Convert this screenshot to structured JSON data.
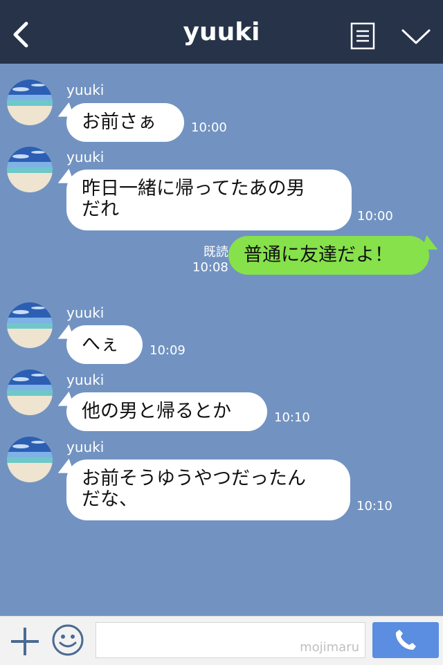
{
  "header": {
    "title": "yuuki"
  },
  "messages": [
    {
      "name": "yuuki",
      "lines": [
        "お前さぁ"
      ],
      "time": "10:00"
    },
    {
      "name": "yuuki",
      "lines": [
        "昨日一緒に帰ってたあの男",
        "だれ"
      ],
      "time": "10:00"
    },
    {
      "mine_text": "普通に友達だよ！",
      "read_label": "既読",
      "time": "10:08"
    },
    {
      "name": "yuuki",
      "lines": [
        "へぇ"
      ],
      "time": "10:09"
    },
    {
      "name": "yuuki",
      "lines": [
        "他の男と帰るとか"
      ],
      "time": "10:10"
    },
    {
      "name": "yuuki",
      "lines": [
        "お前そうゆうやつだったん",
        "だな、"
      ],
      "time": "10:10"
    }
  ],
  "composer": {
    "watermark": "mojimaru"
  },
  "colors": {
    "header": "#263348",
    "background": "#7293c1",
    "my_bubble": "#86e14b",
    "call_button": "#5b8de0"
  },
  "icons": [
    "back-arrow-icon",
    "menu-icon",
    "chevron-down-icon",
    "plus-icon",
    "smiley-icon",
    "phone-icon"
  ]
}
